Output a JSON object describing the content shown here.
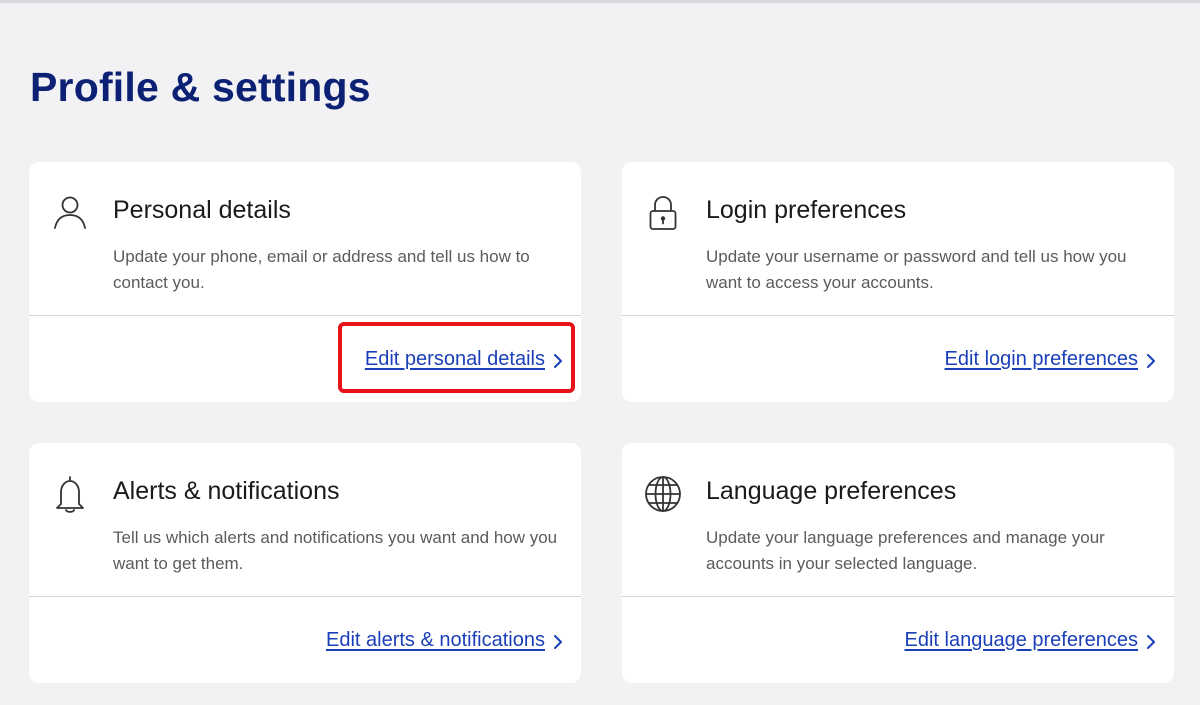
{
  "page": {
    "title": "Profile & settings",
    "highlight_color": "#e8121b",
    "link_color": "#1a3fb8",
    "title_color": "#0c2074"
  },
  "cards": [
    {
      "icon": "person-icon",
      "title": "Personal details",
      "description": "Update your phone, email or address and tell us how to contact you.",
      "link_label": "Edit personal details",
      "highlighted": true
    },
    {
      "icon": "lock-icon",
      "title": "Login preferences",
      "description": "Update your username or password and tell us how you want to access your accounts.",
      "link_label": "Edit login preferences",
      "highlighted": false
    },
    {
      "icon": "bell-icon",
      "title": "Alerts & notifications",
      "description": "Tell us which alerts and notifications you want and how you want to get them.",
      "link_label": "Edit alerts & notifications",
      "highlighted": false
    },
    {
      "icon": "globe-icon",
      "title": "Language preferences",
      "description": "Update your language preferences and manage your accounts in your selected language.",
      "link_label": "Edit language preferences",
      "highlighted": false
    }
  ]
}
